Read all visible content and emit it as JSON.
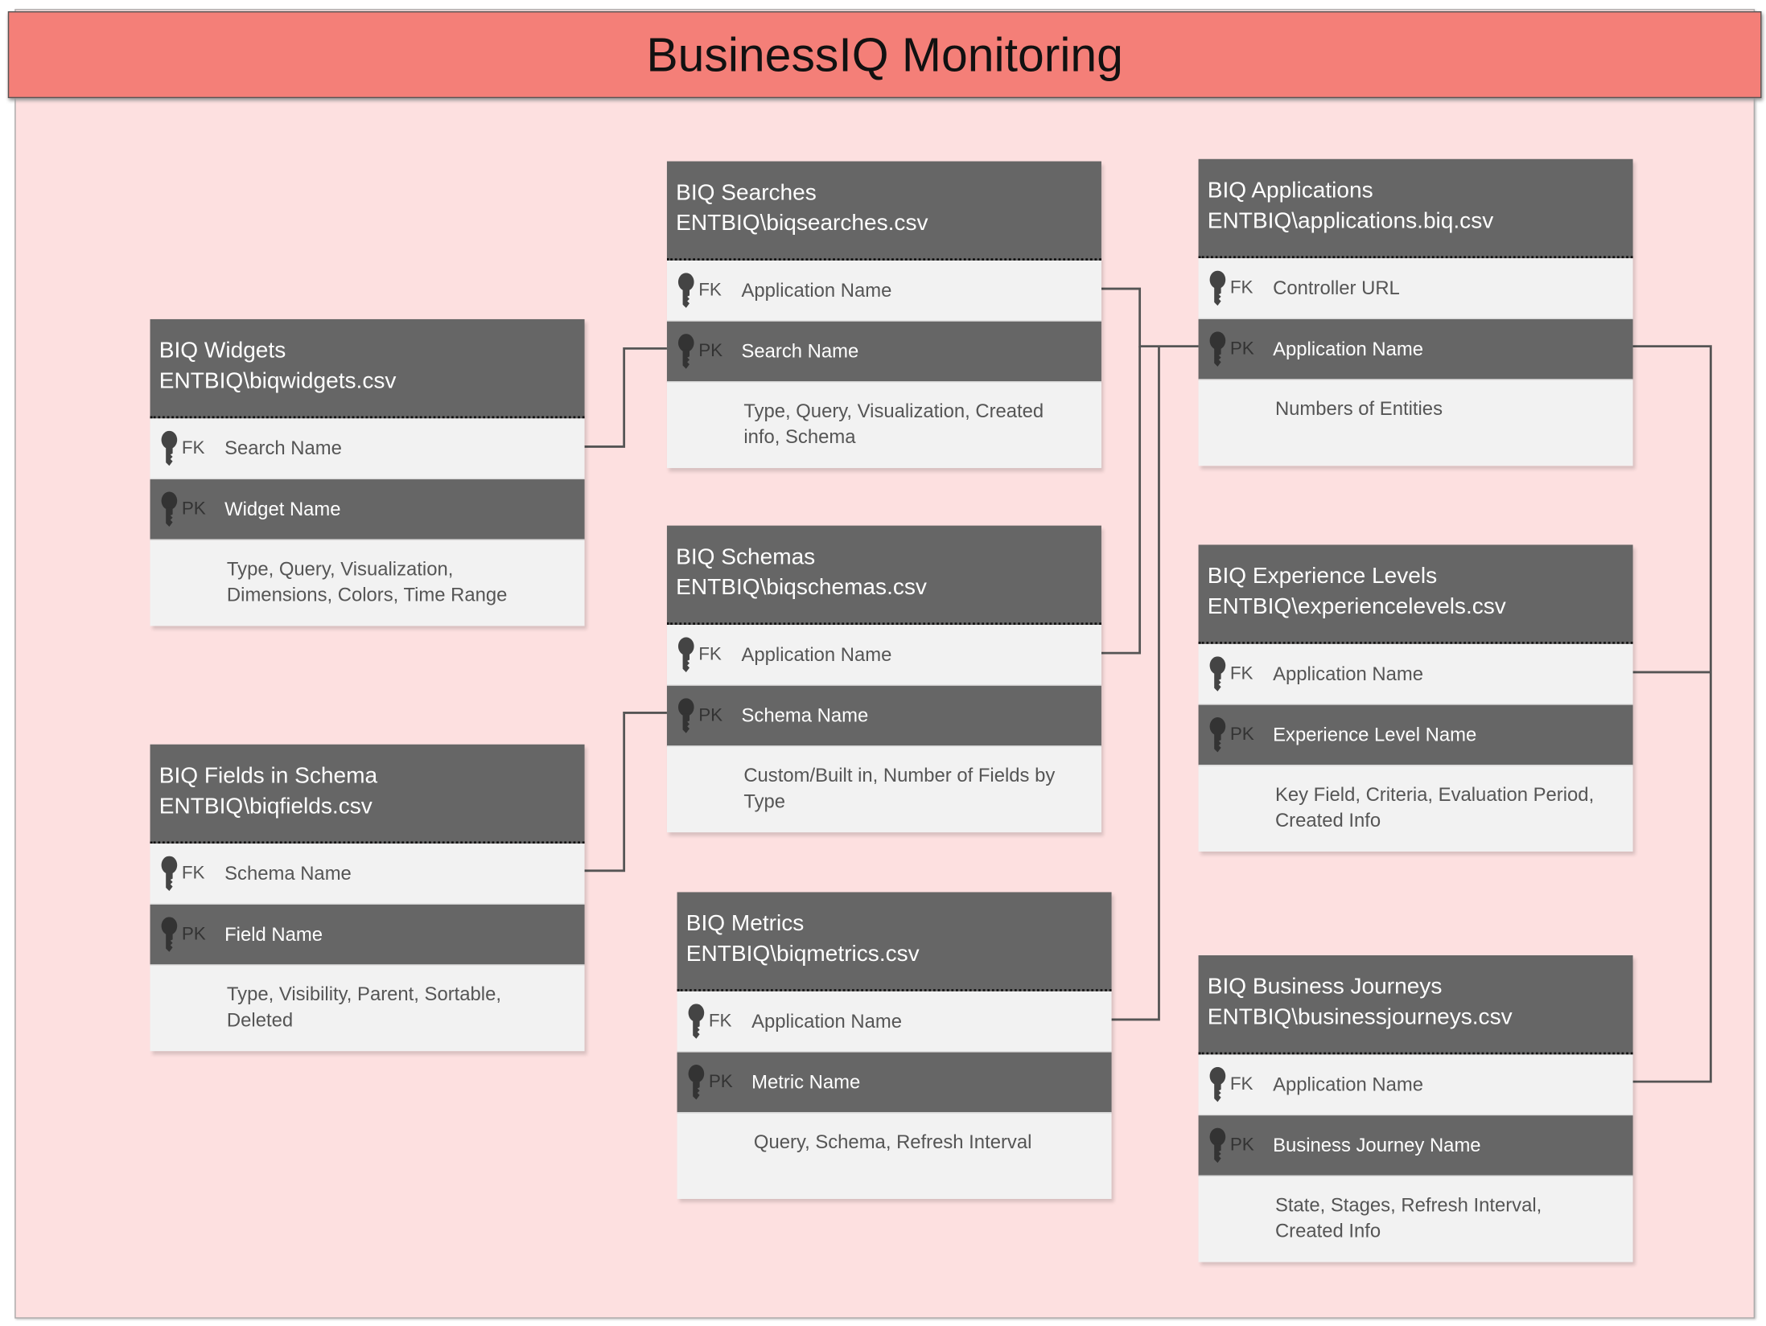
{
  "title": "BusinessIQ Monitoring",
  "tables": [
    {
      "id": "widgets",
      "name": "BIQ Widgets",
      "file": "ENTBIQ\\biqwidgets.csv",
      "fk_label": "FK",
      "fk": "Search Name",
      "pk_label": "PK",
      "pk": "Widget Name",
      "attrs": "Type, Query, Visualization, Dimensions, Colors, Time Range"
    },
    {
      "id": "searches",
      "name": "BIQ Searches",
      "file": "ENTBIQ\\biqsearches.csv",
      "fk_label": "FK",
      "fk": "Application Name",
      "pk_label": "PK",
      "pk": "Search Name",
      "attrs": "Type, Query, Visualization, Created info, Schema"
    },
    {
      "id": "schemas",
      "name": "BIQ Schemas",
      "file": "ENTBIQ\\biqschemas.csv",
      "fk_label": "FK",
      "fk": "Application Name",
      "pk_label": "PK",
      "pk": "Schema Name",
      "attrs": "Custom/Built in, Number of Fields by Type"
    },
    {
      "id": "fields",
      "name": "BIQ Fields in Schema",
      "file": "ENTBIQ\\biqfields.csv",
      "fk_label": "FK",
      "fk": "Schema  Name",
      "pk_label": "PK",
      "pk": "Field  Name",
      "attrs": "Type, Visibility, Parent, Sortable, Deleted"
    },
    {
      "id": "metrics",
      "name": "BIQ Metrics",
      "file": "ENTBIQ\\biqmetrics.csv",
      "fk_label": "FK",
      "fk": "Application Name",
      "pk_label": "PK",
      "pk": "Metric Name",
      "attrs": "Query, Schema, Refresh Interval"
    },
    {
      "id": "applications",
      "name": "BIQ Applications",
      "file": "ENTBIQ\\applications.biq.csv",
      "fk_label": "FK",
      "fk": "Controller URL",
      "pk_label": "PK",
      "pk": "Application Name",
      "attrs": "Numbers of Entities"
    },
    {
      "id": "experience",
      "name": "BIQ Experience Levels",
      "file": "ENTBIQ\\experiencelevels.csv",
      "fk_label": "FK",
      "fk": "Application Name",
      "pk_label": "PK",
      "pk": "Experience Level Name",
      "attrs": "Key Field, Criteria, Evaluation Period, Created Info"
    },
    {
      "id": "journeys",
      "name": "BIQ Business Journeys",
      "file": "ENTBIQ\\businessjourneys.csv",
      "fk_label": "FK",
      "fk": "Application Name",
      "pk_label": "PK",
      "pk": "Business Journey Name",
      "attrs": "State, Stages, Refresh Interval, Created Info"
    }
  ],
  "colors": {
    "title_bar": "#f47f78",
    "background": "#fde0e0",
    "header": "#666666",
    "row_light": "#f2f2f2",
    "connector": "#555555"
  }
}
